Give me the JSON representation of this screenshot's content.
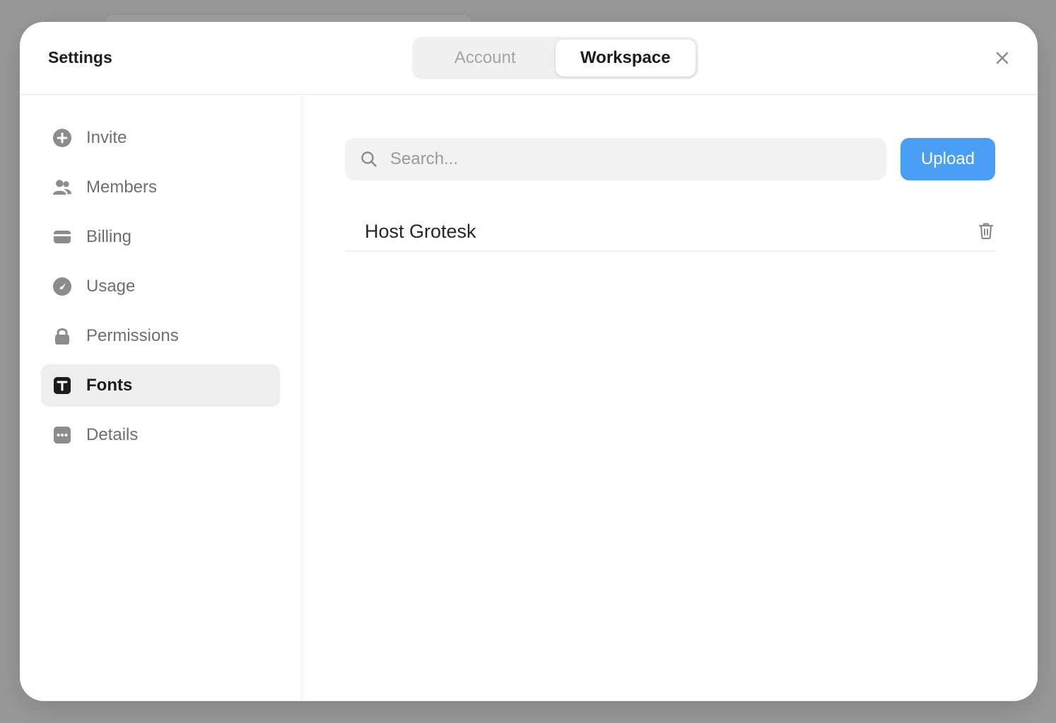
{
  "modal": {
    "title": "Settings",
    "close_icon": "close-icon"
  },
  "tabs": [
    {
      "label": "Account",
      "active": false
    },
    {
      "label": "Workspace",
      "active": true
    }
  ],
  "sidebar": {
    "items": [
      {
        "label": "Invite",
        "icon": "plus-circle-icon",
        "active": false
      },
      {
        "label": "Members",
        "icon": "users-icon",
        "active": false
      },
      {
        "label": "Billing",
        "icon": "credit-card-icon",
        "active": false
      },
      {
        "label": "Usage",
        "icon": "gauge-icon",
        "active": false
      },
      {
        "label": "Permissions",
        "icon": "lock-icon",
        "active": false
      },
      {
        "label": "Fonts",
        "icon": "text-icon",
        "active": true
      },
      {
        "label": "Details",
        "icon": "dots-icon",
        "active": false
      }
    ]
  },
  "content": {
    "search": {
      "placeholder": "Search...",
      "value": ""
    },
    "upload_label": "Upload",
    "fonts": [
      {
        "name": "Host Grotesk"
      }
    ]
  },
  "colors": {
    "accent": "#4a9ff5",
    "icon_gray": "#8c8c8c",
    "active_bg": "#eeeeee"
  }
}
